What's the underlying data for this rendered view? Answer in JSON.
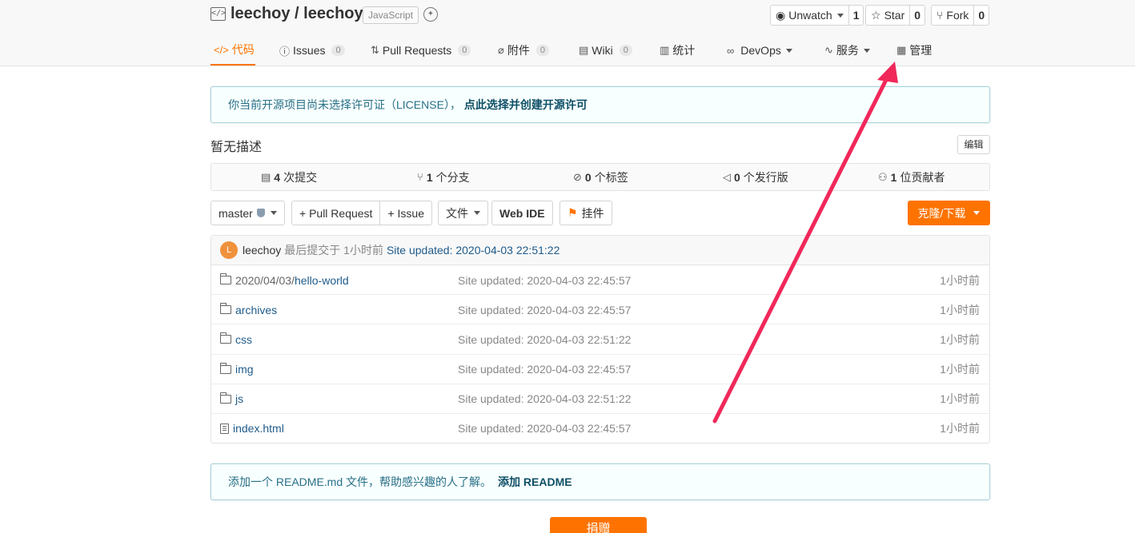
{
  "header": {
    "repo_title": "leechoy / leechoy",
    "language": "JavaScript",
    "unwatch": {
      "label": "Unwatch",
      "count": "1"
    },
    "star": {
      "label": "Star",
      "count": "0"
    },
    "fork": {
      "label": "Fork",
      "count": "0"
    }
  },
  "tabs": [
    {
      "label": "代码",
      "icon": "code-icon"
    },
    {
      "label": "Issues",
      "badge": "0",
      "icon": "issue-icon"
    },
    {
      "label": "Pull Requests",
      "badge": "0",
      "icon": "pull-request-icon"
    },
    {
      "label": "附件",
      "badge": "0",
      "icon": "attachment-icon"
    },
    {
      "label": "Wiki",
      "badge": "0",
      "icon": "wiki-icon"
    },
    {
      "label": "统计",
      "icon": "stats-icon"
    },
    {
      "label": "DevOps",
      "icon": "devops-icon"
    },
    {
      "label": "服务",
      "icon": "service-icon"
    },
    {
      "label": "管理",
      "icon": "manage-icon"
    }
  ],
  "license_notice": {
    "text": "你当前开源项目尚未选择许可证（LICENSE），",
    "link": "点此选择并创建开源许可"
  },
  "description": "暂无描述",
  "edit_label": "编辑",
  "stats": [
    {
      "value": "4",
      "label": "次提交",
      "icon": "commit-icon"
    },
    {
      "value": "1",
      "label": "个分支",
      "icon": "branch-icon"
    },
    {
      "value": "0",
      "label": "个标签",
      "icon": "tag-icon"
    },
    {
      "value": "0",
      "label": "个发行版",
      "icon": "release-icon"
    },
    {
      "value": "1",
      "label": "位贡献者",
      "icon": "contributor-icon"
    }
  ],
  "toolbar": {
    "branch": "master",
    "pull_request": "+ Pull Request",
    "issue": "+ Issue",
    "files": "文件",
    "web_ide": "Web IDE",
    "widget": "挂件",
    "clone": "克隆/下载"
  },
  "last_commit": {
    "avatar_letter": "L",
    "author": "leechoy",
    "meta": "最后提交于 1小时前",
    "message": "Site updated: 2020-04-03 22:51:22"
  },
  "files": [
    {
      "prefix": "2020/04/03/",
      "name": "hello-world",
      "type": "folder",
      "message": "Site updated: 2020-04-03 22:45:57",
      "time": "1小时前"
    },
    {
      "prefix": "",
      "name": "archives",
      "type": "folder",
      "message": "Site updated: 2020-04-03 22:45:57",
      "time": "1小时前"
    },
    {
      "prefix": "",
      "name": "css",
      "type": "folder",
      "message": "Site updated: 2020-04-03 22:51:22",
      "time": "1小时前"
    },
    {
      "prefix": "",
      "name": "img",
      "type": "folder",
      "message": "Site updated: 2020-04-03 22:45:57",
      "time": "1小时前"
    },
    {
      "prefix": "",
      "name": "js",
      "type": "folder",
      "message": "Site updated: 2020-04-03 22:51:22",
      "time": "1小时前"
    },
    {
      "prefix": "",
      "name": "index.html",
      "type": "file",
      "message": "Site updated: 2020-04-03 22:45:57",
      "time": "1小时前"
    }
  ],
  "readme_notice": {
    "text": "添加一个 README.md 文件，帮助感兴趣的人了解。",
    "link": "添加 README"
  },
  "donate_label": "捐赠",
  "colors": {
    "accent": "#fe7300",
    "annotation_arrow": "#f0285a",
    "link": "#1f5b8a"
  }
}
